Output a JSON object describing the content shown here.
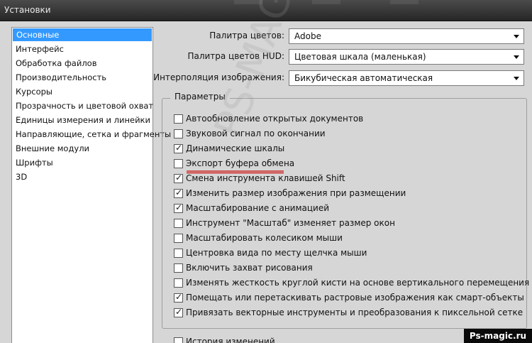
{
  "window": {
    "title": "Установки"
  },
  "sidebar": {
    "items": [
      {
        "label": "Основные",
        "selected": true
      },
      {
        "label": "Интерфейс"
      },
      {
        "label": "Обработка файлов"
      },
      {
        "label": "Производительность"
      },
      {
        "label": "Курсоры"
      },
      {
        "label": "Прозрачность и цветовой охват"
      },
      {
        "label": "Единицы измерения и линейки"
      },
      {
        "label": "Направляющие, сетка и фрагменты"
      },
      {
        "label": "Внешние модули"
      },
      {
        "label": "Шрифты"
      },
      {
        "label": "3D"
      }
    ]
  },
  "settings": {
    "color_picker": {
      "label": "Палитра цветов:",
      "value": "Adobe"
    },
    "hud_picker": {
      "label": "Палитра цветов HUD:",
      "value": "Цветовая шкала (маленькая)"
    },
    "interpolation": {
      "label": "Интерполяция изображения:",
      "value": "Бикубическая автоматическая"
    }
  },
  "options": {
    "title": "Параметры",
    "items": [
      {
        "label": "Автообновление открытых документов",
        "checked": false
      },
      {
        "label": "Звуковой сигнал по окончании",
        "checked": false
      },
      {
        "label": "Динамические шкалы",
        "checked": true
      },
      {
        "label": "Экспорт буфера обмена",
        "checked": false,
        "highlighted": true
      },
      {
        "label": "Смена инструмента клавишей Shift",
        "checked": true
      },
      {
        "label": "Изменить размер изображения при размещении",
        "checked": true
      },
      {
        "label": "Масштабирование с анимацией",
        "checked": true
      },
      {
        "label": "Инструмент \"Масштаб\" изменяет размер окон",
        "checked": false
      },
      {
        "label": "Масштабировать колесиком мыши",
        "checked": false
      },
      {
        "label": "Центровка вида по месту щелчка мыши",
        "checked": false
      },
      {
        "label": "Включить захват рисования",
        "checked": false
      },
      {
        "label": "Изменять жесткость круглой кисти на основе вертикального перемещения HUD",
        "checked": false
      },
      {
        "label": "Помещать или перетаскивать растровые изображения как смарт-объекты",
        "checked": true
      },
      {
        "label": "Привязать векторные инструменты и преобразования к пиксельной сетке",
        "checked": true
      }
    ]
  },
  "history": {
    "label": "История изменений"
  },
  "watermark": {
    "text": "PS-MAGIC.RU"
  },
  "badge": {
    "text": "Ps-magic.ru"
  },
  "colors": {
    "selection": "#3399ff",
    "highlight_underline": "#cc0000"
  }
}
